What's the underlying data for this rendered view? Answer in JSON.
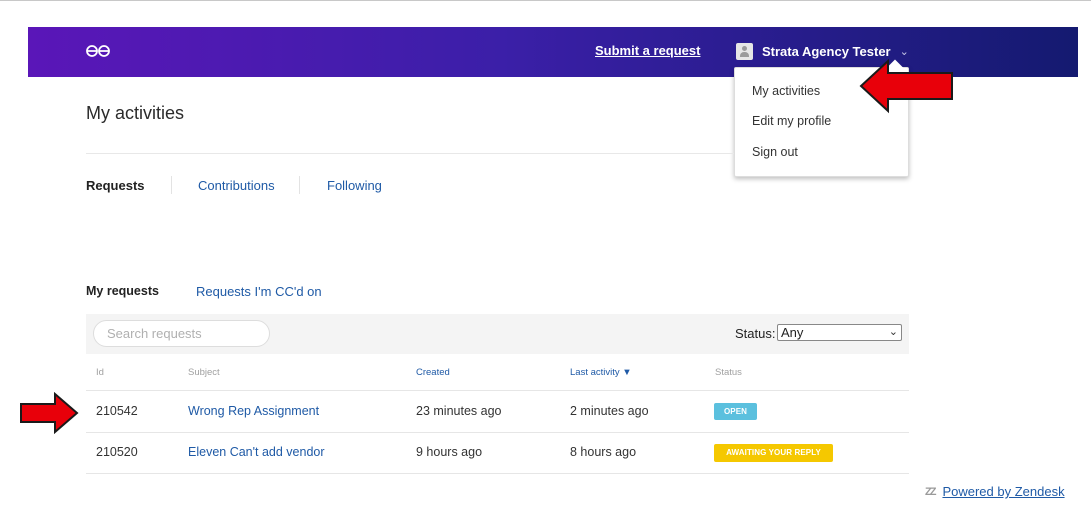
{
  "header": {
    "submit_label": "Submit a request",
    "user_name": "Strata Agency Tester",
    "logo_icon": "brand-logo-icon",
    "colors": {
      "gradient_start": "#5a16b8",
      "gradient_end": "#141a70"
    }
  },
  "user_menu": {
    "items": [
      {
        "label": "My activities"
      },
      {
        "label": "Edit my profile"
      },
      {
        "label": "Sign out"
      }
    ]
  },
  "page": {
    "title": "My activities",
    "subnav": [
      {
        "label": "Requests",
        "active": true
      },
      {
        "label": "Contributions",
        "active": false
      },
      {
        "label": "Following",
        "active": false
      }
    ]
  },
  "requests": {
    "tabs": [
      {
        "label": "My requests",
        "active": true
      },
      {
        "label": "Requests I'm CC'd on",
        "active": false
      }
    ],
    "search_placeholder": "Search requests",
    "status_label": "Status:",
    "status_value": "Any",
    "columns": [
      "Id",
      "Subject",
      "Created",
      "Last activity ▼",
      "Status"
    ],
    "rows": [
      {
        "id": "210542",
        "subject": "Wrong Rep Assignment",
        "created": "23 minutes ago",
        "last_activity": "2 minutes ago",
        "status": "OPEN",
        "status_color": "#5bc0de"
      },
      {
        "id": "210520",
        "subject": "Eleven Can't add vendor",
        "created": "9 hours ago",
        "last_activity": "8 hours ago",
        "status": "AWAITING YOUR REPLY",
        "status_color": "#f5c800"
      }
    ]
  },
  "footer": {
    "powered_by": "Powered by Zendesk",
    "icon": "zendesk-icon"
  },
  "annotations": {
    "arrow_color": "#e8000a"
  }
}
